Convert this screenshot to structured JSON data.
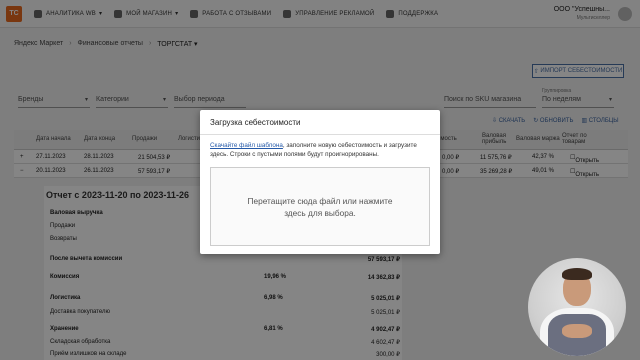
{
  "topbar": {
    "logo": "ТС",
    "nav": [
      {
        "label": "АНАЛИТИКА WB",
        "caret": "▾"
      },
      {
        "label": "МОЙ МАГАЗИН",
        "caret": "▾"
      },
      {
        "label": "РАБОТА С ОТЗЫВАМИ",
        "caret": ""
      },
      {
        "label": "УПРАВЛЕНИЕ РЕКЛАМОЙ",
        "caret": ""
      },
      {
        "label": "ПОДДЕРЖКА",
        "caret": ""
      }
    ],
    "org_name": "ООО \"Успешны...",
    "org_sub": "Мультиселлер"
  },
  "breadcrumbs": [
    "Яндекс Маркет",
    "Финансовые отчеты",
    "ТОРГСТАТ ▾"
  ],
  "import_button": "ИМПОРТ СЕБЕСТОИМОСТИ",
  "filters": {
    "brands": "Бренды",
    "categories": "Категории",
    "period": "Выбор периода",
    "search": "Поиск по SKU магазина",
    "grouping_label": "Группировка",
    "grouping": "По неделям"
  },
  "actions": {
    "download": "СКАЧАТЬ",
    "refresh": "ОБНОВИТЬ",
    "columns": "СТОЛБЦЫ"
  },
  "table": {
    "headers": {
      "start": "Дата начала",
      "end": "Дата конца",
      "sales": "Продажи",
      "logistics": "Логистик",
      "cost": "...имость",
      "gross": "Валовая прибыль",
      "margin": "Валовая маржа",
      "report": "Отчет по товарам"
    },
    "rows": [
      {
        "toggle": "+",
        "start": "27.11.2023",
        "end": "28.11.2023",
        "sales": "21 504,53 ₽",
        "cost": "0,00 ₽",
        "gross": "11 575,76 ₽",
        "margin": "42,37 %",
        "open": "Открыть"
      },
      {
        "toggle": "−",
        "start": "20.11.2023",
        "end": "26.11.2023",
        "sales": "57 593,17 ₽",
        "cost": "0,00 ₽",
        "gross": "35 269,28 ₽",
        "margin": "49,01 %",
        "open": "Открыть"
      }
    ]
  },
  "detail": {
    "title": "Отчет с 2023-11-20 по 2023-11-26",
    "rows": [
      {
        "label": "Валовая выручка",
        "pct": "",
        "value": "",
        "bold": true
      },
      {
        "label": "Продажи",
        "pct": "",
        "value": "",
        "bold": false
      },
      {
        "label": "Возвраты",
        "pct": "",
        "value": "",
        "bold": false
      },
      {
        "label": "После вычета комиссии",
        "pct": "",
        "value": "57 593,17 ₽",
        "bold": true
      },
      {
        "label": "Комиссия",
        "pct": "19,96 %",
        "value": "14 362,83 ₽",
        "bold": true
      },
      {
        "label": "Логистика",
        "pct": "6,98 %",
        "value": "5 025,01 ₽",
        "bold": true
      },
      {
        "label": "Доставка покупателю",
        "pct": "",
        "value": "5 025,01 ₽",
        "bold": false
      },
      {
        "label": "Хранение",
        "pct": "6,81 %",
        "value": "4 902,47 ₽",
        "bold": true
      },
      {
        "label": "Складская обработка",
        "pct": "",
        "value": "4 602,47 ₽",
        "bold": false
      },
      {
        "label": "Приём излишков на складе",
        "pct": "",
        "value": "300,00 ₽",
        "bold": false
      }
    ]
  },
  "modal": {
    "title": "Загрузка себестоимости",
    "link": "Скачайте файл шаблона",
    "text": ", заполните новую себестоимость и загрузите здесь. Строки с пустыми полями будут проигнорированы.",
    "dropzone": "Перетащите сюда файл или нажмите здесь для выбора."
  }
}
